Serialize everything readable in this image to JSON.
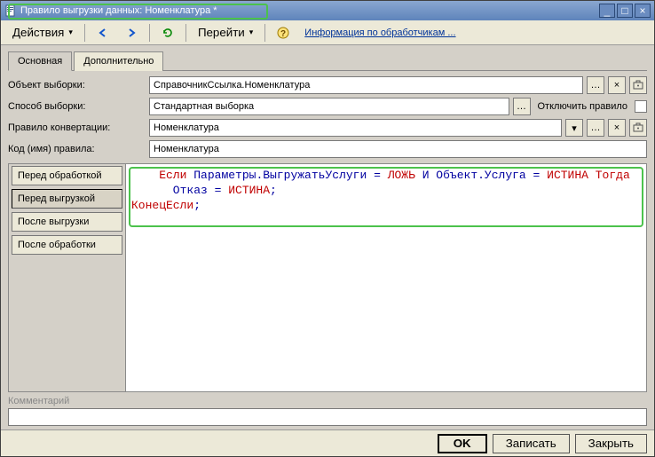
{
  "window": {
    "title": "Правило выгрузки данных: Номенклатура *"
  },
  "toolbar": {
    "actions": "Действия",
    "goto": "Перейти",
    "info_link": "Информация по обработчикам ..."
  },
  "tabs": {
    "main": "Основная",
    "more": "Дополнительно"
  },
  "form": {
    "select_obj_label": "Объект выборки:",
    "select_obj_value": "СправочникСсылка.Номенклатура",
    "select_mode_label": "Способ выборки:",
    "select_mode_value": "Стандартная выборка",
    "disable_rule_label": "Отключить правило",
    "conv_rule_label": "Правило конвертации:",
    "conv_rule_value": "Номенклатура",
    "code_label": "Код (имя) правила:",
    "code_value": "Номенклатура"
  },
  "sidebar": {
    "before_proc": "Перед обработкой",
    "before_unload": "Перед выгрузкой",
    "after_unload": "После выгрузки",
    "after_proc": "После обработки"
  },
  "code": {
    "l1_kw1": "Если",
    "l1_txt1": " Параметры.ВыгружатьУслуги = ",
    "l1_kw2": "ЛОЖЬ",
    "l1_txt2": " И Объект.Услуга = ",
    "l1_kw3": "ИСТИНА",
    "l1_kw4": " Тогда",
    "l2_txt": "      Отказ = ",
    "l2_kw": "ИСТИНА",
    "l2_sc": ";",
    "l3_kw": "КонецЕсли",
    "l3_sc": ";"
  },
  "comment_label": "Комментарий",
  "footer": {
    "ok": "OK",
    "save": "Записать",
    "close": "Закрыть"
  }
}
